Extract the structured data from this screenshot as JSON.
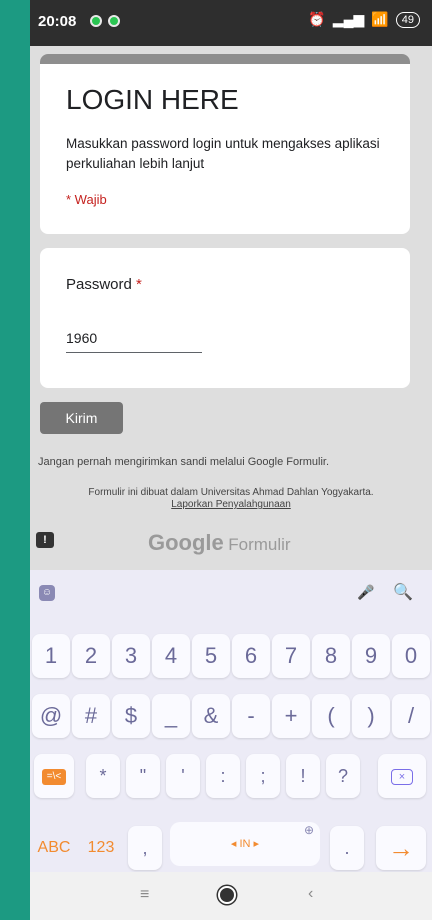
{
  "status_bar": {
    "time": "20:08",
    "battery": "49"
  },
  "form": {
    "title": "LOGIN HERE",
    "description": "Masukkan password login untuk mengakses aplikasi perkuliahan lebih lanjut",
    "required_note": "* Wajib",
    "question": {
      "label": "Password",
      "required_mark": "*",
      "value": "1960"
    },
    "submit_label": "Kirim",
    "warning": "Jangan pernah mengirimkan sandi melalui Google Formulir.",
    "footer_info": "Formulir ini dibuat dalam Universitas Ahmad Dahlan Yogyakarta.",
    "abuse_link": "Laporkan Penyalahgunaan",
    "brand_google": "Google",
    "brand_forms": "Formulir"
  },
  "keyboard": {
    "digits": [
      "1",
      "2",
      "3",
      "4",
      "5",
      "6",
      "7",
      "8",
      "9",
      "0"
    ],
    "symbols_row": [
      "@",
      "#",
      "$",
      "_",
      "&",
      "-",
      "+",
      "(",
      ")",
      "/"
    ],
    "symbols_row2": [
      "*",
      "\"",
      "'",
      ":",
      ";",
      "!",
      "?"
    ],
    "emoji_switch": "=\\<",
    "abc": "ABC",
    "num": "123",
    "comma": ",",
    "space": "◂ IN ▸",
    "period": ".",
    "enter": "→"
  },
  "icons": {
    "accent": "#f28b30",
    "key_text": "#6b6a99"
  }
}
